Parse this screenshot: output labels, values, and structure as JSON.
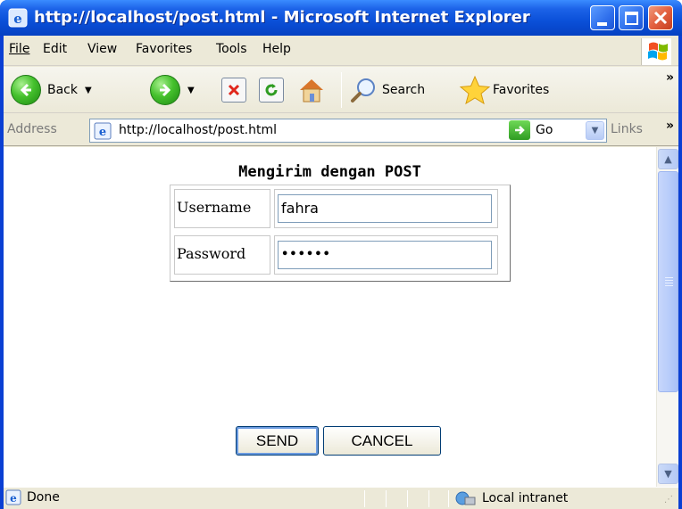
{
  "window": {
    "title": "http://localhost/post.html - Microsoft Internet Explorer"
  },
  "menu": {
    "items": [
      "File",
      "Edit",
      "View",
      "Favorites",
      "Tools",
      "Help"
    ],
    "underline_keys": [
      "F",
      "E",
      "V",
      "a",
      "T",
      "H"
    ]
  },
  "toolbar": {
    "back_label": "Back",
    "search_label": "Search",
    "favorites_label": "Favorites",
    "overflow": "»"
  },
  "address": {
    "label": "Address",
    "url": "http://localhost/post.html",
    "go_label": "Go",
    "links_label": "Links",
    "links_overflow": "»"
  },
  "page": {
    "heading": "Mengirim dengan POST",
    "username_label": "Username",
    "username_value": "fahra",
    "password_label": "Password",
    "password_value": "••••••",
    "send_label": "SEND",
    "cancel_label": "CANCEL"
  },
  "status": {
    "text": "Done",
    "zone": "Local intranet"
  },
  "colors": {
    "titlebar": "#0a4fd8",
    "accent_green": "#45c12d",
    "button_border": "#003c74"
  },
  "icons": [
    "ie-icon",
    "minimize-icon",
    "maximize-icon",
    "close-icon",
    "back-icon",
    "forward-icon",
    "stop-icon",
    "refresh-icon",
    "home-icon",
    "search-icon",
    "favorites-star-icon",
    "go-arrow-icon",
    "intranet-icon"
  ]
}
